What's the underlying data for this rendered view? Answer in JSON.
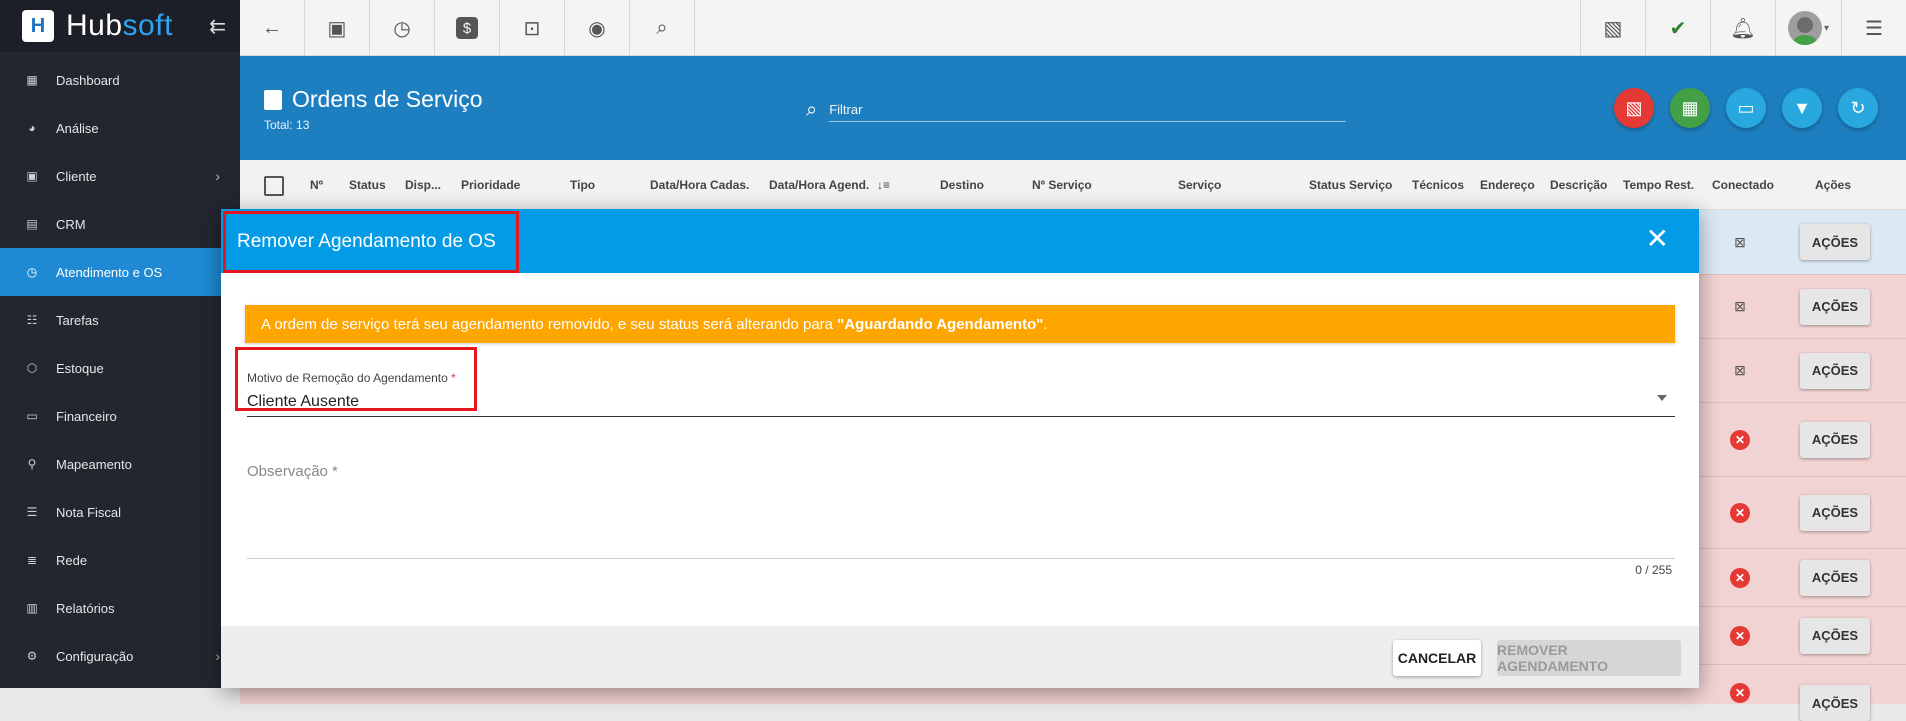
{
  "app": {
    "logo_text_1": "Hub",
    "logo_text_2": "soft"
  },
  "sidebar": {
    "items": [
      {
        "label": "Dashboard",
        "icon": "grid-icon"
      },
      {
        "label": "Análise",
        "icon": "pie-chart-icon"
      },
      {
        "label": "Cliente",
        "icon": "contact-icon",
        "has_submenu": true
      },
      {
        "label": "CRM",
        "icon": "board-icon"
      },
      {
        "label": "Atendimento e OS",
        "icon": "calendar-clock-icon",
        "active": true
      },
      {
        "label": "Tarefas",
        "icon": "tasks-icon"
      },
      {
        "label": "Estoque",
        "icon": "box-icon"
      },
      {
        "label": "Financeiro",
        "icon": "cash-icon"
      },
      {
        "label": "Mapeamento",
        "icon": "map-pin-icon"
      },
      {
        "label": "Nota Fiscal",
        "icon": "receipt-icon"
      },
      {
        "label": "Rede",
        "icon": "server-icon"
      },
      {
        "label": "Relatórios",
        "icon": "report-icon"
      },
      {
        "label": "Configuração",
        "icon": "gear-icon",
        "has_submenu": true
      }
    ]
  },
  "topbar": {
    "icons": [
      "back-arrow-icon",
      "contact-card-icon",
      "calendar-clock-icon",
      "dollar-icon",
      "terminal-icon",
      "eye-icon",
      "search-icon"
    ],
    "right_icons": [
      "pdf-icon",
      "chat-check-icon",
      "bell-icon",
      "avatar",
      "menu-icon"
    ]
  },
  "header": {
    "title": "Ordens de Serviço",
    "total": "Total: 13",
    "filter_placeholder": "Filtrar"
  },
  "table": {
    "columns": [
      "Nº",
      "Status",
      "Disp...",
      "Prioridade",
      "Tipo",
      "Data/Hora Cadas.",
      "Data/Hora Agend.",
      "Destino",
      "Nº Serviço",
      "Serviço",
      "Status Serviço",
      "Técnicos",
      "Endereço",
      "Descrição",
      "Tempo Rest.",
      "Conectado",
      "Ações"
    ],
    "action_label": "AÇÕES"
  },
  "modal": {
    "title": "Remover Agendamento de OS",
    "alert_prefix": "A ordem de serviço terá seu agendamento removido, e seu status será alterando para ",
    "alert_bold": "\"Aguardando Agendamento\"",
    "alert_suffix": ".",
    "reason_label": "Motivo de Remoção do Agendamento",
    "reason_required": "*",
    "reason_value": "Cliente Ausente",
    "obs_label": "Observação *",
    "counter": "0 / 255",
    "cancel_label": "CANCELAR",
    "remove_label": "REMOVER AGENDAMENTO"
  },
  "colors": {
    "sidebar_bg": "#23262f",
    "active_nav": "#1f8ad3",
    "header_bg": "#1e7fc0",
    "modal_header": "#039be5",
    "alert": "#ffa500",
    "highlight": "#e5161d",
    "pdf_btn": "#e53935",
    "excel_btn": "#43a047",
    "monitor_btn": "#29a8e0",
    "filter_btn": "#29a8e0",
    "refresh_btn": "#29a8e0"
  }
}
